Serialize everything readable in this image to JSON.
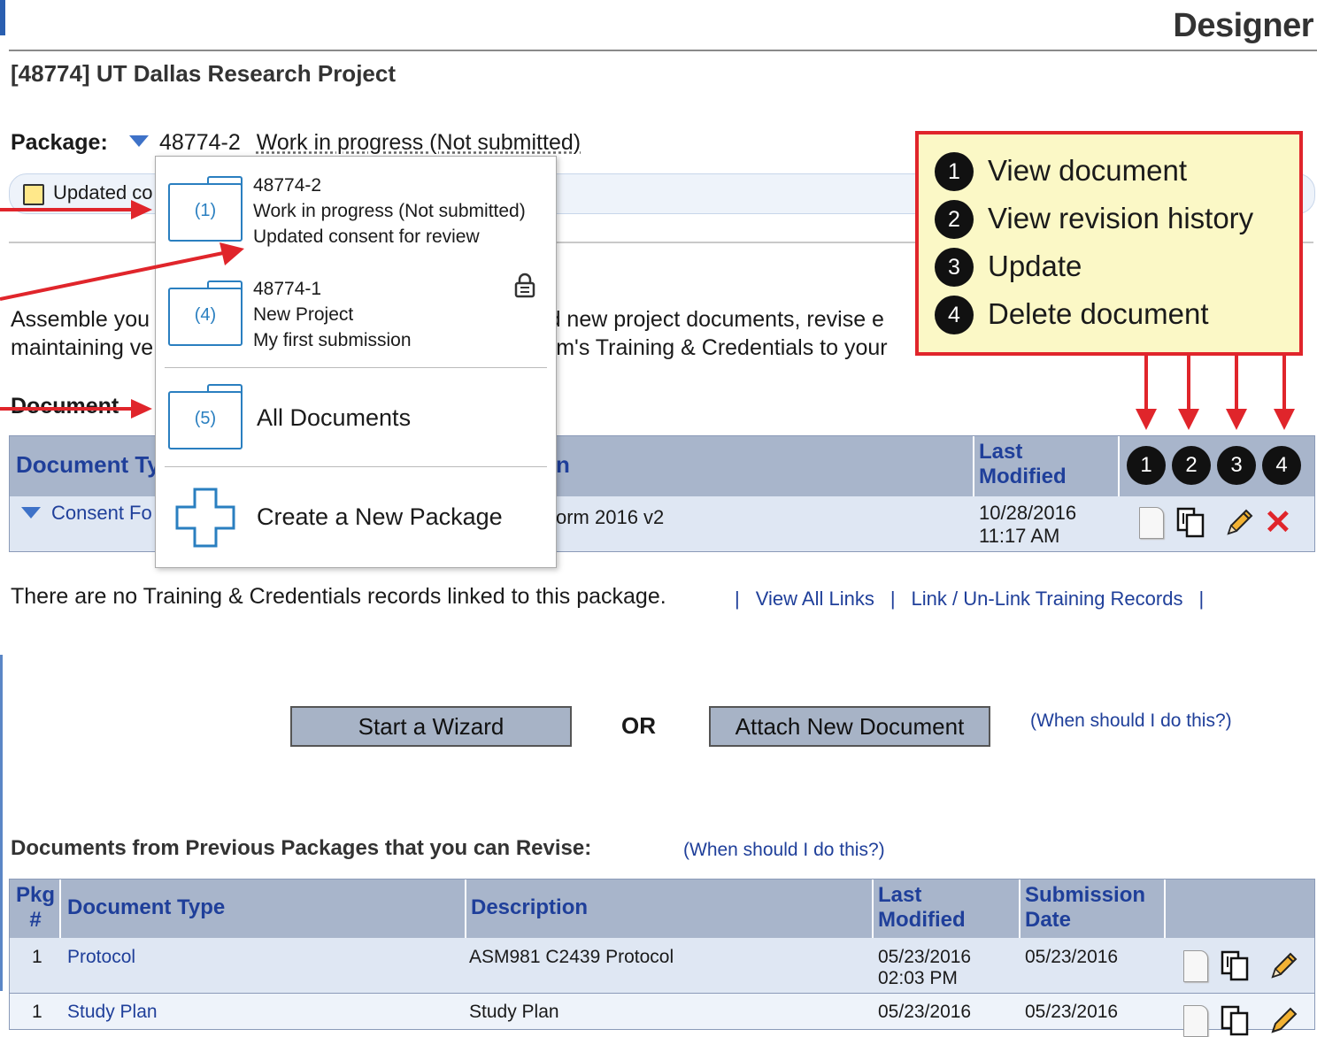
{
  "header": {
    "app_title": "Designer",
    "project_title": "[48774] UT Dallas Research Project"
  },
  "package": {
    "label": "Package:",
    "selected_id": "48774-2",
    "selected_status": "Work in progress (Not submitted)"
  },
  "comment": {
    "text": "Updated co"
  },
  "intro": {
    "line1_left": "Assemble you",
    "line1_right": "ld new project documents, revise e",
    "line2_left": "maintaining ve",
    "line2_right": "m's Training & Credentials to your"
  },
  "documents_heading": "Document",
  "docs_table": {
    "col_doctype": "Document Ty",
    "col_desc": "n",
    "col_last_line1": "Last",
    "col_last_line2": "Modified",
    "row": {
      "doctype": "Consent Fo",
      "desc": "orm 2016 v2",
      "date": "10/28/2016",
      "time": "11:17 AM"
    }
  },
  "action_numbers": [
    "1",
    "2",
    "3",
    "4"
  ],
  "legend": [
    {
      "num": "1",
      "label": "View document"
    },
    {
      "num": "2",
      "label": "View revision history"
    },
    {
      "num": "3",
      "label": "Update"
    },
    {
      "num": "4",
      "label": "Delete document"
    }
  ],
  "popup": {
    "pkg1": {
      "count": "(1)",
      "id": "48774-2",
      "status": "Work in progress (Not submitted)",
      "comment": "Updated consent for review"
    },
    "pkg2": {
      "count": "(4)",
      "id": "48774-1",
      "status": "New Project",
      "comment": "My first submission"
    },
    "all": {
      "count": "(5)",
      "label": "All Documents"
    },
    "create": {
      "label": "Create a New Package"
    }
  },
  "training": {
    "text": "There are no Training & Credentials records linked to this package.",
    "view_all": "View All Links",
    "link_unlink": "Link / Un-Link Training Records",
    "separator": "|"
  },
  "actions": {
    "wizard": "Start a Wizard",
    "or": "OR",
    "attach": "Attach New Document",
    "when": "(When should I do this?)"
  },
  "previous": {
    "heading": "Documents from Previous Packages that you can Revise:",
    "when": "(When should I do this?)",
    "col_pkg_line1": "Pkg",
    "col_pkg_line2": "#",
    "col_doctype": "Document Type",
    "col_desc": "Description",
    "col_last_line1": "Last",
    "col_last_line2": "Modified",
    "col_sub_line1": "Submission",
    "col_sub_line2": "Date",
    "rows": [
      {
        "pkg": "1",
        "doctype": "Protocol",
        "desc": "ASM981 C2439 Protocol",
        "date": "05/23/2016",
        "time": "02:03 PM",
        "submitted": "05/23/2016"
      },
      {
        "pkg": "1",
        "doctype": "Study Plan",
        "desc": "Study Plan",
        "date": "05/23/2016",
        "submitted": "05/23/2016"
      }
    ]
  },
  "colors": {
    "accent_red": "#e0252b",
    "link_blue": "#1f3f9a",
    "header_fill": "#a8b5cb",
    "row_fill": "#dfe7f3",
    "legend_fill": "#fbf8c6"
  },
  "icons": [
    "chevron-down-icon",
    "note-icon",
    "folder-icon",
    "lock-icon",
    "plus-icon",
    "document-icon",
    "copy-history-icon",
    "pencil-icon",
    "delete-x-icon"
  ]
}
